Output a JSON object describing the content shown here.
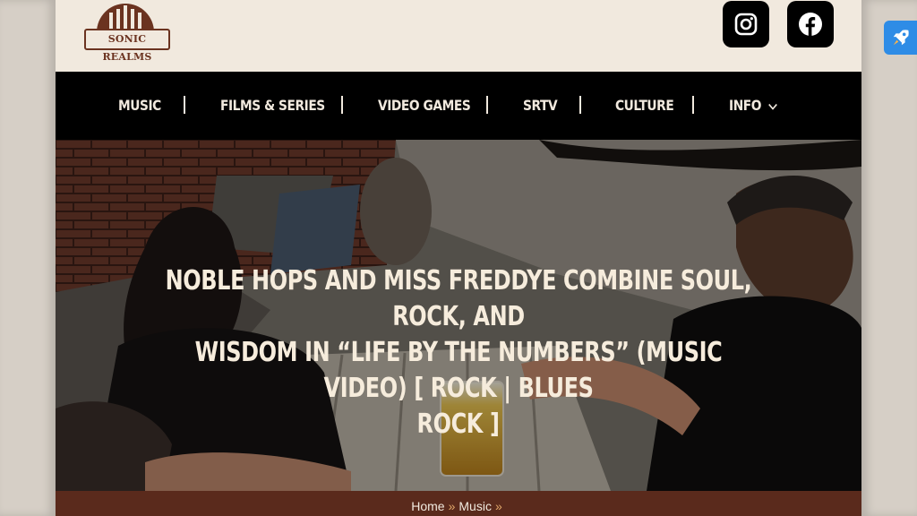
{
  "brand": {
    "logo_text": "SONIC REALMS"
  },
  "social": {
    "instagram_icon": "instagram-icon",
    "facebook_icon": "facebook-icon"
  },
  "nav": {
    "items": [
      {
        "label": "MUSIC"
      },
      {
        "label": "FILMS & SERIES"
      },
      {
        "label": "VIDEO GAMES"
      },
      {
        "label": "SRTV"
      },
      {
        "label": "CULTURE"
      },
      {
        "label": "INFO"
      }
    ],
    "separator": "|"
  },
  "hero": {
    "title_line1": "NOBLE HOPS AND MISS FREDDYE COMBINE SOUL, ROCK, AND",
    "title_line2": "WISDOM IN “LIFE BY THE NUMBERS” (MUSIC VIDEO) [ ROCK | BLUES",
    "title_line3": "ROCK ]"
  },
  "breadcrumb": {
    "home": "Home",
    "sep": "»",
    "music": "Music"
  },
  "colors": {
    "background": "#f1e9de",
    "nav_bg": "#000000",
    "brand_brown": "#6b3320",
    "breadcrumb_bg": "#5a2a1c",
    "breadcrumb_sep": "#e2a86a",
    "rocket_bg": "#2e8ce6"
  },
  "widgets": {
    "rocket_icon": "rocket-icon"
  }
}
